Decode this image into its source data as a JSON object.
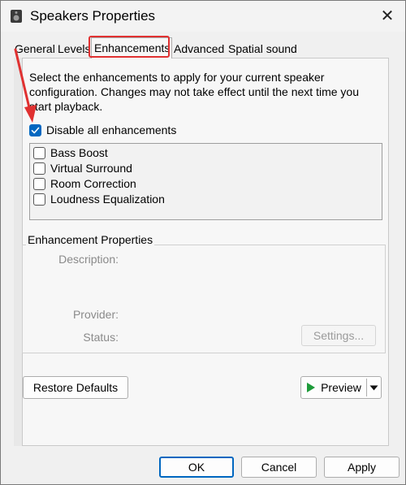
{
  "window": {
    "title": "Speakers Properties",
    "close_glyph": "✕"
  },
  "tabs": [
    {
      "label": "General",
      "active": false
    },
    {
      "label": "Levels",
      "active": false
    },
    {
      "label": "Enhancements",
      "active": true
    },
    {
      "label": "Advanced",
      "active": false
    },
    {
      "label": "Spatial sound",
      "active": false
    }
  ],
  "enhancements": {
    "description": "Select the enhancements to apply for your current speaker configuration. Changes may not take effect until the next time you start playback.",
    "disable_all_label": "Disable all enhancements",
    "disable_all_checked": true,
    "items": [
      {
        "label": "Bass Boost",
        "checked": false
      },
      {
        "label": "Virtual Surround",
        "checked": false
      },
      {
        "label": "Room Correction",
        "checked": false
      },
      {
        "label": "Loudness Equalization",
        "checked": false
      }
    ]
  },
  "properties": {
    "group_label": "Enhancement Properties",
    "description_label": "Description:",
    "provider_label": "Provider:",
    "status_label": "Status:",
    "settings_button": "Settings..."
  },
  "actions": {
    "restore_defaults": "Restore Defaults",
    "preview": "Preview"
  },
  "footer": {
    "ok": "OK",
    "cancel": "Cancel",
    "apply": "Apply"
  },
  "colors": {
    "accent": "#0067c0",
    "annotation_red": "#e03131",
    "preview_green": "#1e9b3a"
  },
  "icons": {
    "app": "speaker-icon",
    "close": "close-icon",
    "check": "checkmark-icon",
    "play": "play-icon",
    "dropdown": "chevron-down-icon"
  }
}
